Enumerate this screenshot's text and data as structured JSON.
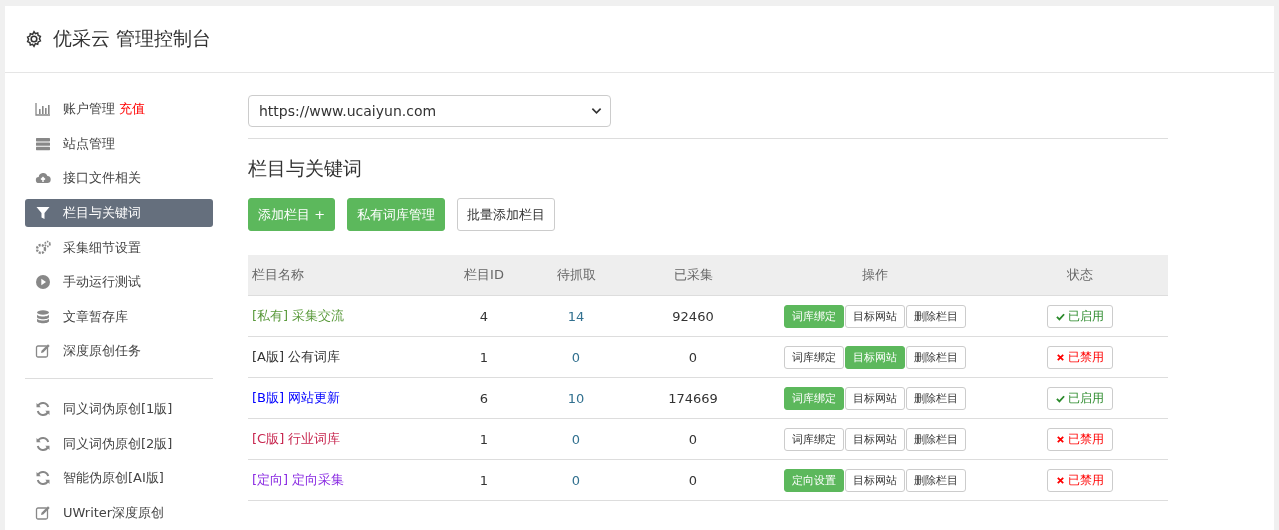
{
  "header": {
    "title": "优采云 管理控制台"
  },
  "sidebar": {
    "groups": [
      {
        "items": [
          {
            "label": "账户管理",
            "badge": "充值",
            "selected": false
          },
          {
            "label": "站点管理",
            "selected": false
          },
          {
            "label": "接口文件相关",
            "selected": false
          },
          {
            "label": "栏目与关键词",
            "selected": true
          },
          {
            "label": "采集细节设置",
            "selected": false
          },
          {
            "label": "手动运行测试",
            "selected": false
          },
          {
            "label": "文章暂存库",
            "selected": false
          },
          {
            "label": "深度原创任务",
            "selected": false
          }
        ]
      },
      {
        "items": [
          {
            "label": "同义词伪原创[1版]",
            "selected": false
          },
          {
            "label": "同义词伪原创[2版]",
            "selected": false
          },
          {
            "label": "智能伪原创[AI版]",
            "selected": false
          },
          {
            "label": "UWriter深度原创",
            "selected": false
          }
        ]
      }
    ]
  },
  "site_select": {
    "value": "https://www.ucaiyun.com"
  },
  "section_title": "栏目与关键词",
  "toolbar": [
    {
      "label": "添加栏目 +",
      "kind": "primary"
    },
    {
      "label": "私有词库管理",
      "kind": "primary"
    },
    {
      "label": "批量添加栏目",
      "kind": "default"
    }
  ],
  "table": {
    "columns": [
      "栏目名称",
      "栏目ID",
      "待抓取",
      "已采集",
      "操作",
      "状态"
    ],
    "rows": [
      {
        "color": "#5a9a3c",
        "cells": [
          "[私有] 采集交流",
          "4",
          "14",
          "92460"
        ],
        "actions": [
          {
            "label": "词库绑定",
            "kind": "primary"
          },
          {
            "label": "目标网站",
            "kind": "default"
          },
          {
            "label": "删除栏目",
            "kind": "default"
          }
        ],
        "status": {
          "label": "已启用",
          "enabled": true
        }
      },
      {
        "color": "#333333",
        "cells": [
          "[A版] 公有词库",
          "1",
          "0",
          "0"
        ],
        "actions": [
          {
            "label": "词库绑定",
            "kind": "default"
          },
          {
            "label": "目标网站",
            "kind": "primary"
          },
          {
            "label": "删除栏目",
            "kind": "default"
          }
        ],
        "status": {
          "label": "已禁用",
          "enabled": false
        }
      },
      {
        "color": "#0000ff",
        "cells": [
          "[B版] 网站更新",
          "6",
          "10",
          "174669"
        ],
        "actions": [
          {
            "label": "词库绑定",
            "kind": "primary"
          },
          {
            "label": "目标网站",
            "kind": "default"
          },
          {
            "label": "删除栏目",
            "kind": "default"
          }
        ],
        "status": {
          "label": "已启用",
          "enabled": true
        }
      },
      {
        "color": "#c7254e",
        "cells": [
          "[C版] 行业词库",
          "1",
          "0",
          "0"
        ],
        "actions": [
          {
            "label": "词库绑定",
            "kind": "default"
          },
          {
            "label": "目标网站",
            "kind": "default"
          },
          {
            "label": "删除栏目",
            "kind": "default"
          }
        ],
        "status": {
          "label": "已禁用",
          "enabled": false
        }
      },
      {
        "color": "#8a2be2",
        "cells": [
          "[定向] 定向采集",
          "1",
          "0",
          "0"
        ],
        "actions": [
          {
            "label": "定向设置",
            "kind": "primary"
          },
          {
            "label": "目标网站",
            "kind": "default"
          },
          {
            "label": "删除栏目",
            "kind": "default"
          }
        ],
        "status": {
          "label": "已禁用",
          "enabled": false
        }
      }
    ]
  }
}
